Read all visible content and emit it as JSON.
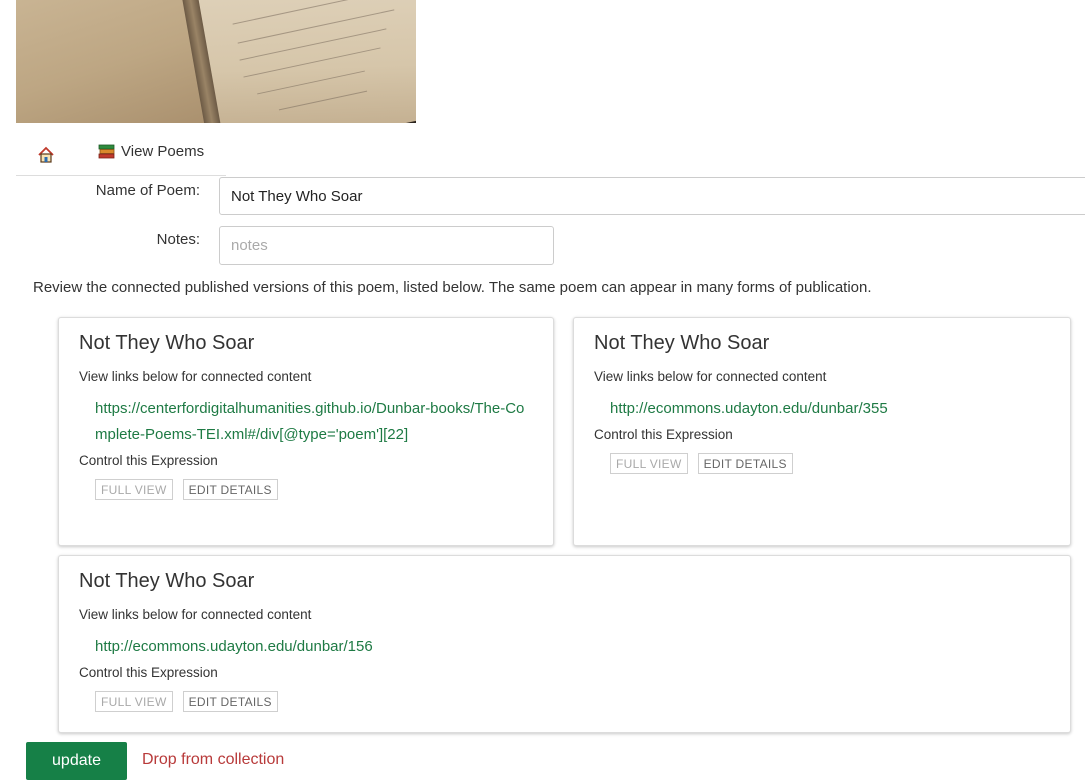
{
  "nav": {
    "home_icon": "home-icon",
    "view_poems_icon": "books-icon",
    "view_poems_label": "View Poems"
  },
  "form": {
    "name_label": "Name of Poem:",
    "name_value": "Not They Who Soar",
    "notes_label": "Notes:",
    "notes_placeholder": "notes"
  },
  "review_text": "Review the connected published versions of this poem, listed below. The same poem can appear in many forms of publication.",
  "expressions": [
    {
      "title": "Not They Who Soar",
      "links_heading": "View links below for connected content",
      "link": "https://centerfordigitalhumanities.github.io/Dunbar-books/The-Complete-Poems-TEI.xml#/div[@type='poem'][22]",
      "control_heading": "Control this Expression",
      "full_view_label": "FULL VIEW",
      "edit_details_label": "EDIT DETAILS"
    },
    {
      "title": "Not They Who Soar",
      "links_heading": "View links below for connected content",
      "link": "http://ecommons.udayton.edu/dunbar/355",
      "control_heading": "Control this Expression",
      "full_view_label": "FULL VIEW",
      "edit_details_label": "EDIT DETAILS"
    },
    {
      "title": "Not They Who Soar",
      "links_heading": "View links below for connected content",
      "link": "http://ecommons.udayton.edu/dunbar/156",
      "control_heading": "Control this Expression",
      "full_view_label": "FULL VIEW",
      "edit_details_label": "EDIT DETAILS"
    }
  ],
  "actions": {
    "update_label": "update",
    "drop_label": "Drop from collection"
  },
  "colors": {
    "link_green": "#1e7a44",
    "update_button": "#168047",
    "drop_red": "#b83a3a"
  }
}
